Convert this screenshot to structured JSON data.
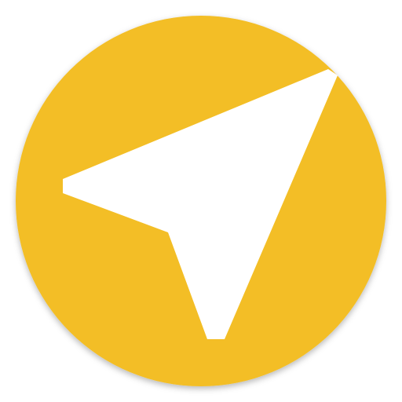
{
  "app_icon": {
    "icon": "navigation-arrow-icon",
    "colors": {
      "background_circle": "#F3BE25",
      "arrow": "#FFFFFF",
      "shadow": "#000000"
    }
  }
}
